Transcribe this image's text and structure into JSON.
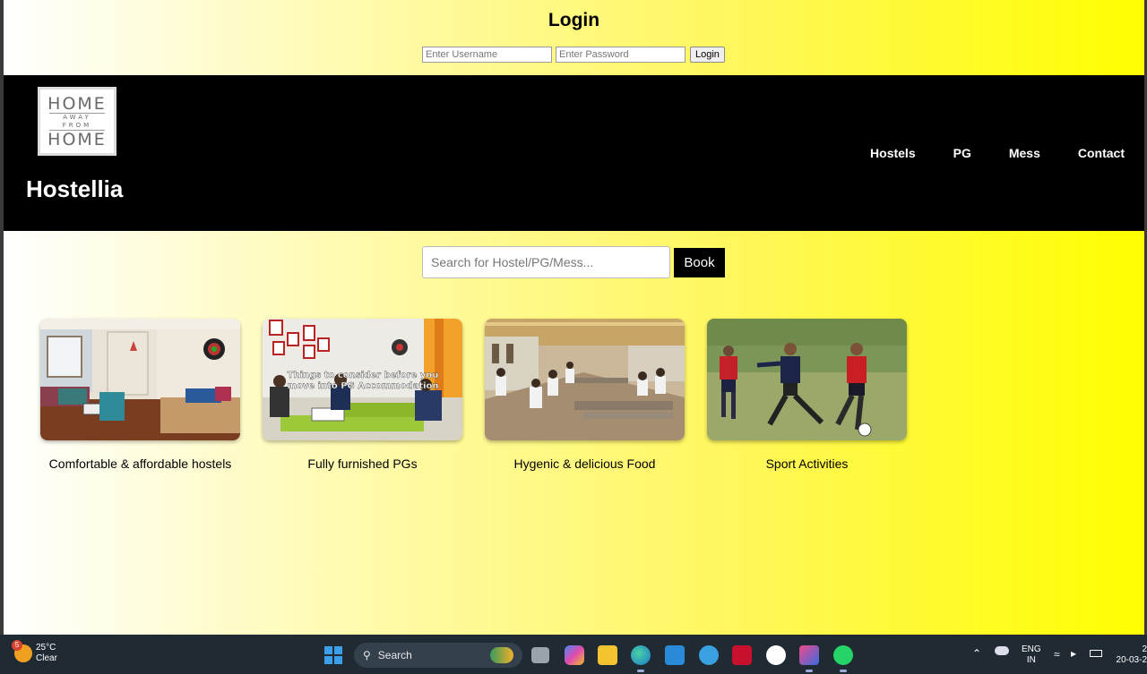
{
  "login": {
    "title": "Login",
    "username_placeholder": "Enter Username",
    "password_placeholder": "Enter Password",
    "button_label": "Login"
  },
  "header": {
    "logo_top": "HOME",
    "logo_mid1": "AWAY",
    "logo_mid2": "FROM",
    "logo_bottom": "HOME",
    "brand": "Hostellia",
    "nav": [
      "Hostels",
      "PG",
      "Mess",
      "Contact"
    ]
  },
  "search": {
    "placeholder": "Search for Hostel/PG/Mess...",
    "button_label": "Book"
  },
  "cards": [
    {
      "caption": "Comfortable & affordable hostels"
    },
    {
      "caption": "Fully furnished PGs",
      "overlay_line1": "Things to consider before you",
      "overlay_line2": "move into PG Accommodation"
    },
    {
      "caption": "Hygenic & delicious Food"
    },
    {
      "caption": "Sport Activities"
    }
  ],
  "taskbar": {
    "weather_badge": "5",
    "temperature": "25°C",
    "condition": "Clear",
    "search_label": "Search",
    "lang_top": "ENG",
    "lang_bottom": "IN",
    "time": "2",
    "date": "20-03-2"
  }
}
